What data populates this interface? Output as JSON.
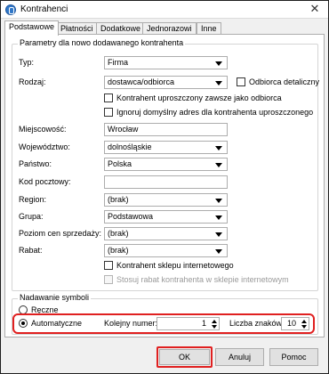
{
  "window": {
    "title": "Kontrahenci",
    "close_glyph": "✕"
  },
  "tabs": [
    {
      "label": "Podstawowe"
    },
    {
      "label": "Płatności"
    },
    {
      "label": "Dodatkowe"
    },
    {
      "label": "Jednorazowi"
    },
    {
      "label": "Inne"
    }
  ],
  "params": {
    "group_title": "Parametry dla nowo dodawanego kontrahenta",
    "typ": {
      "label": "Typ:",
      "value": "Firma"
    },
    "rodzaj": {
      "label": "Rodzaj:",
      "value": "dostawca/odbiorca"
    },
    "odbiorca_detaliczny": {
      "label": "Odbiorca detaliczny",
      "checked": false
    },
    "kontrahent_uproszczony": {
      "label": "Kontrahent uproszczony zawsze jako odbiorca",
      "checked": false
    },
    "ignoruj_adres": {
      "label": "Ignoruj domyślny adres dla kontrahenta uproszczonego",
      "checked": false
    },
    "miejscowosc": {
      "label": "Miejscowość:",
      "value": "Wrocław"
    },
    "wojewodztwo": {
      "label": "Województwo:",
      "value": "dolnośląskie"
    },
    "panstwo": {
      "label": "Państwo:",
      "value": "Polska"
    },
    "kod_pocztowy": {
      "label": "Kod pocztowy:",
      "value": ""
    },
    "region": {
      "label": "Region:",
      "value": "(brak)"
    },
    "grupa": {
      "label": "Grupa:",
      "value": "Podstawowa"
    },
    "poziom_cen": {
      "label": "Poziom cen sprzedaży:",
      "value": "(brak)"
    },
    "rabat": {
      "label": "Rabat:",
      "value": "(brak)"
    },
    "kontrahent_sklepu": {
      "label": "Kontrahent sklepu internetowego",
      "checked": false
    },
    "stosuj_rabat": {
      "label": "Stosuj rabat kontrahenta w sklepie internetowym",
      "checked": false
    }
  },
  "symbols": {
    "group_title": "Nadawanie symboli",
    "reczne": {
      "label": "Ręczne",
      "selected": false
    },
    "automatyczne": {
      "label": "Automatyczne",
      "selected": true
    },
    "kolejny_numer": {
      "label": "Kolejny numer:",
      "value": "1"
    },
    "liczba_znakow": {
      "label": "Liczba znaków:",
      "value": "10"
    }
  },
  "buttons": {
    "ok": "OK",
    "anuluj": "Anuluj",
    "pomoc": "Pomoc"
  },
  "colors": {
    "highlight": "#e02020",
    "accent": "#2f77c8"
  }
}
